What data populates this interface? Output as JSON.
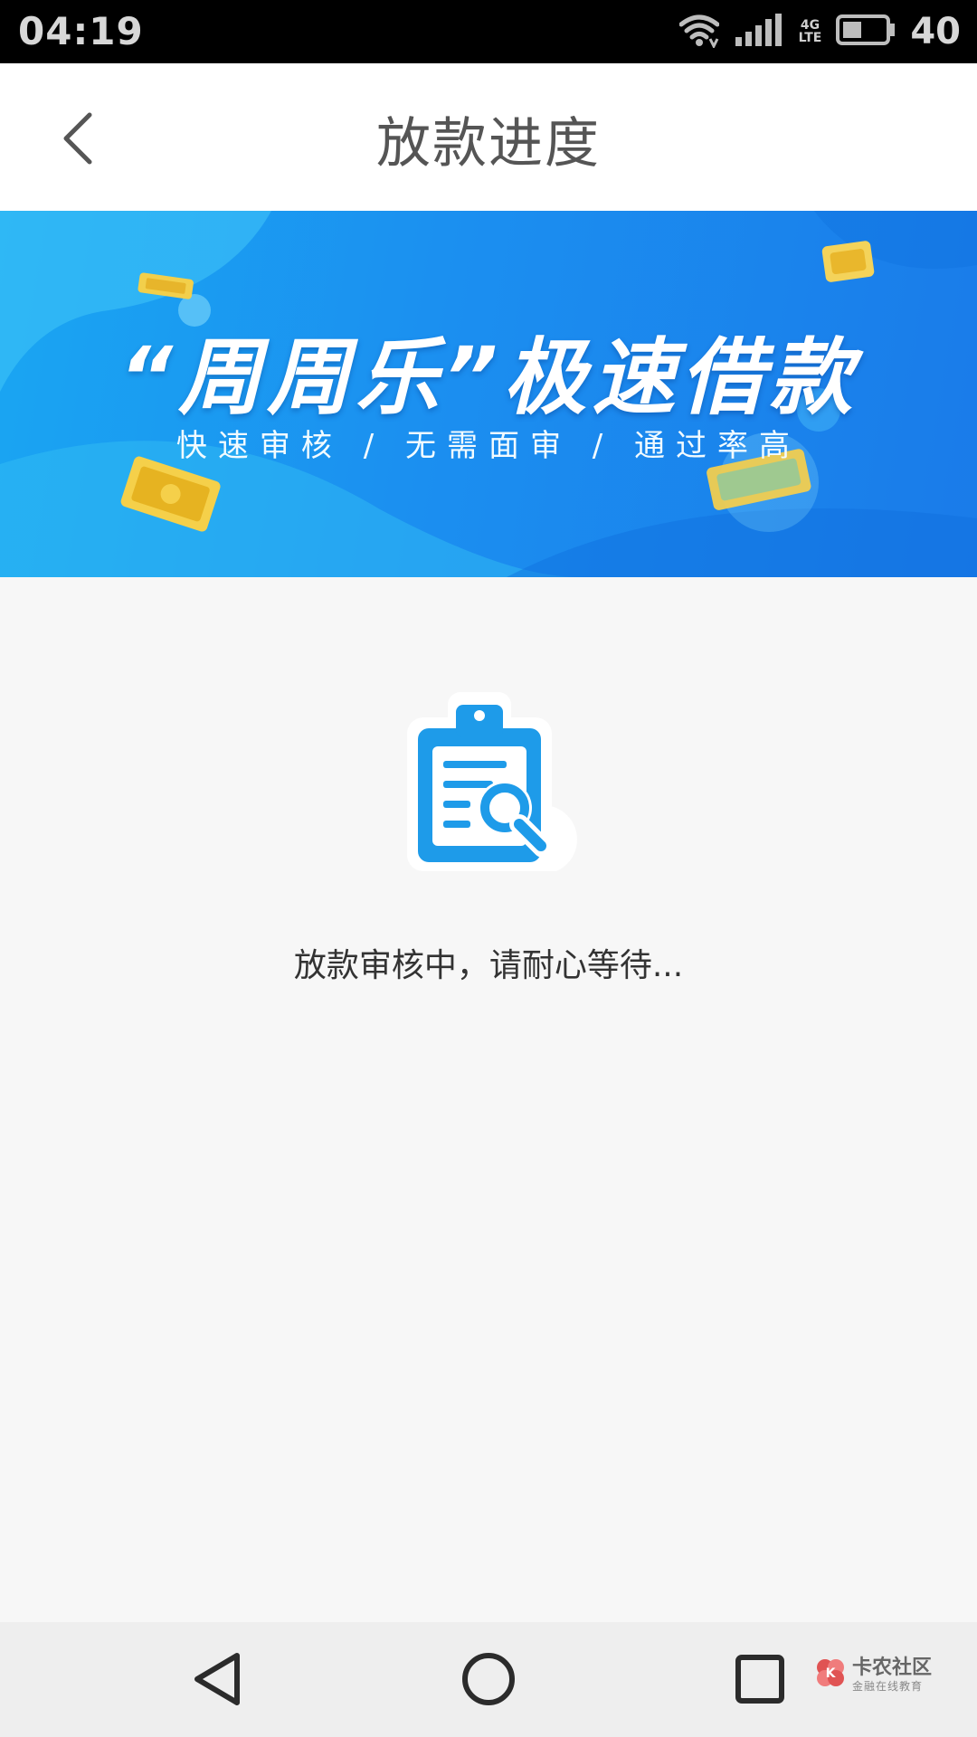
{
  "status_bar": {
    "time": "04:19",
    "network_top": "4G",
    "network_bottom": "LTE",
    "battery": "40"
  },
  "header": {
    "title": "放款进度"
  },
  "banner": {
    "title": "“周周乐”极速借款",
    "subtitle": "快速审核 / 无需面审 / 通过率高"
  },
  "main": {
    "status_text": "放款审核中，请耐心等待..."
  },
  "watermark": {
    "main": "卡农社区",
    "sub": "金融在线教育"
  },
  "colors": {
    "accent": "#1e9be9",
    "banner_gold": "#f2cf4b"
  }
}
